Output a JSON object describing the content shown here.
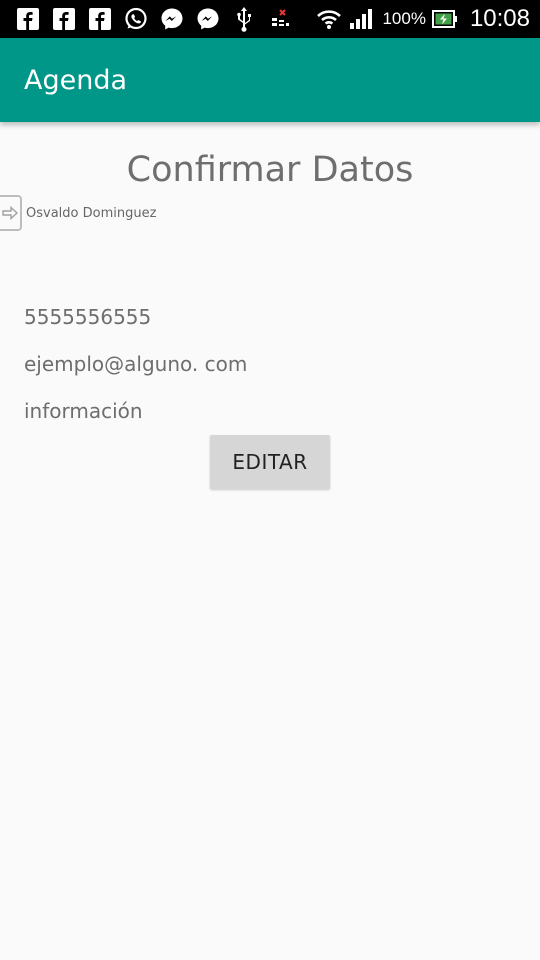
{
  "status_bar": {
    "battery_percent": "100%",
    "time": "10:08",
    "notification_icons": [
      "facebook-icon",
      "facebook-icon",
      "facebook-icon",
      "whatsapp-icon",
      "messenger-icon",
      "messenger-icon",
      "usb-icon",
      "signal-off-icon"
    ]
  },
  "app_bar": {
    "title": "Agenda",
    "color": "#009688"
  },
  "screen": {
    "title": "Confirmar Datos",
    "contact_name": "Osvaldo Dominguez",
    "phone": "5555556555",
    "email": "ejemplo@alguno. com",
    "info": "información",
    "edit_label": "EDITAR"
  }
}
